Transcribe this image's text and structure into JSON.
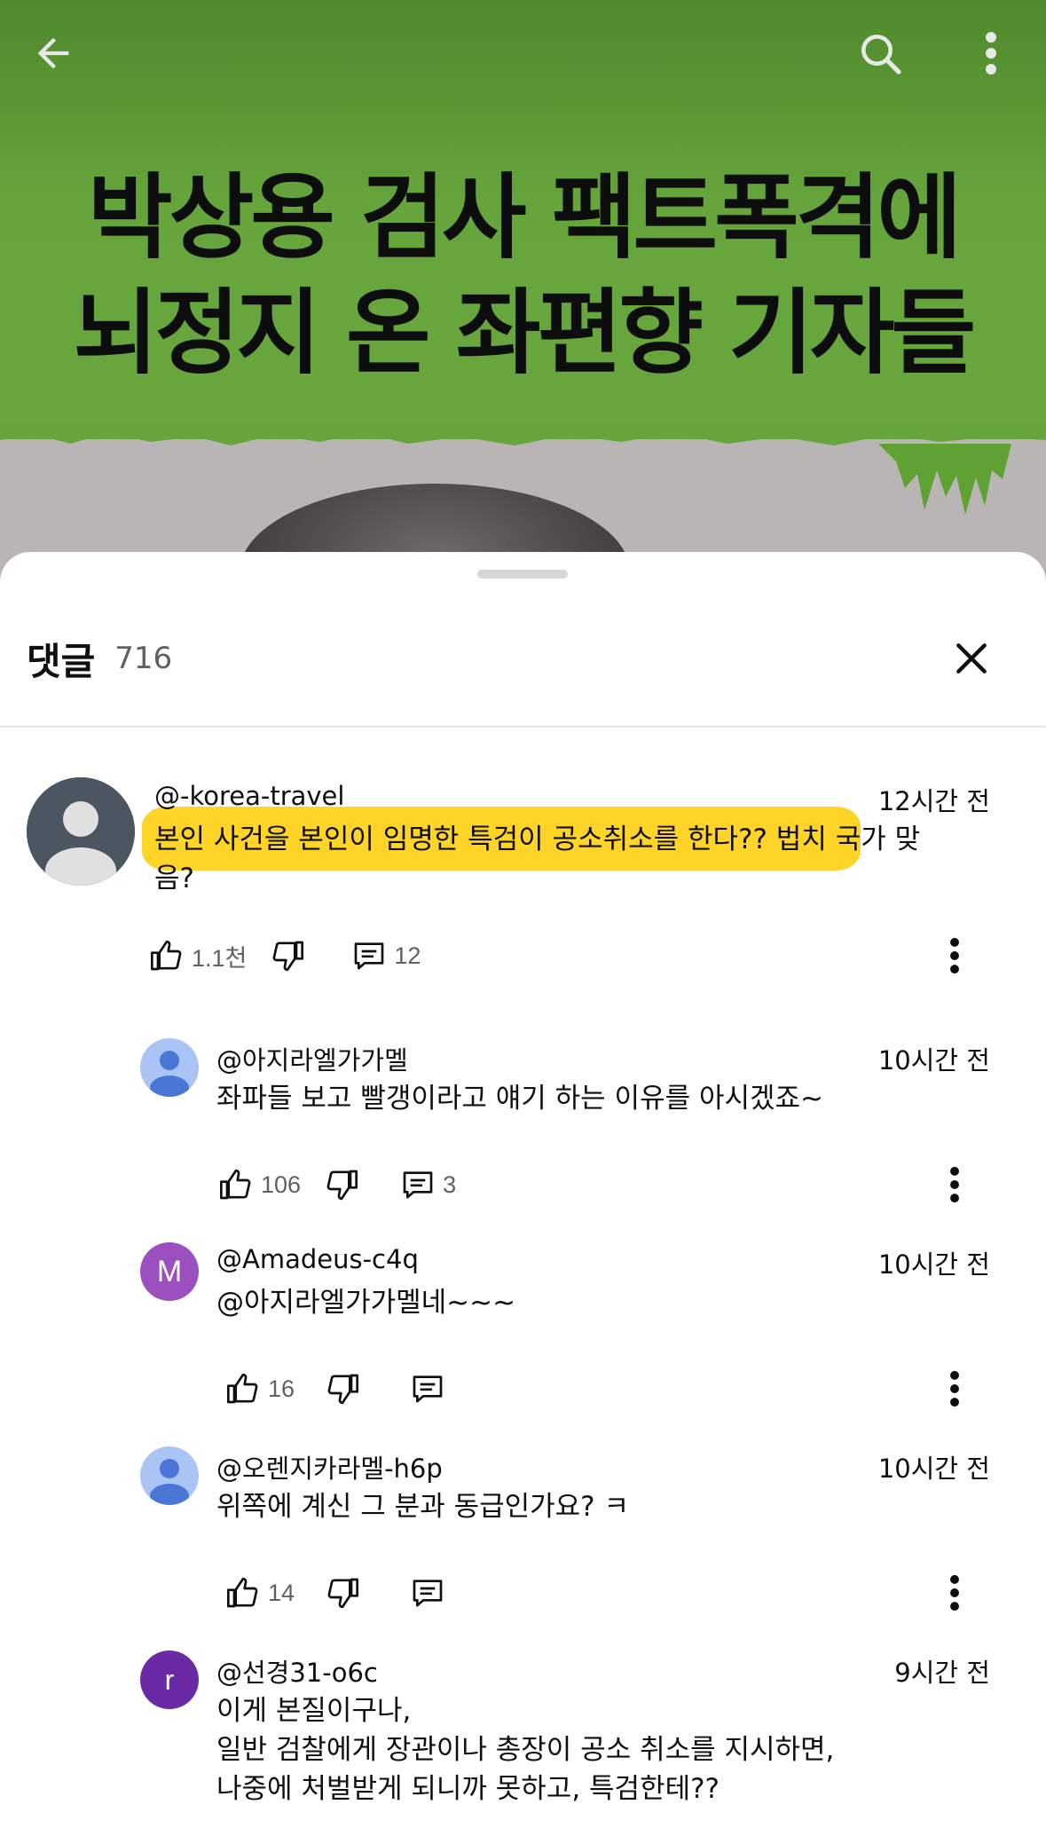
{
  "video": {
    "title_line1": "박상용 검사 팩트폭격에",
    "title_line2": "뇌정지 온 좌편향 기자들"
  },
  "icons": {
    "back": "back-arrow-icon",
    "search": "search-icon",
    "more": "more-vertical-icon",
    "close": "close-icon",
    "like": "thumbs-up-icon",
    "dislike": "thumbs-down-icon",
    "reply": "reply-icon"
  },
  "colors": {
    "video_green": "#66a53c",
    "highlight": "#ffd21e",
    "avatar_default_bg": "#a9c4f5",
    "avatar_default_fg": "#4a77d6",
    "avatar_m": "#9c4fbf",
    "avatar_r": "#6a2aa6"
  },
  "comments_panel": {
    "title": "댓글",
    "count": "716"
  },
  "comments": [
    {
      "author": "@-korea-travel",
      "time": "12시간 전",
      "text_line1": "본인 사건을 본인이 임명한 특검이 공소취소를 한다?? 법치 국가 맞",
      "text_line2": "음?",
      "likes": "1.1천",
      "replies": "12"
    },
    {
      "author": "@아지라엘가가멜",
      "time": "10시간 전",
      "text": "좌파들 보고 빨갱이라고 얘기 하는 이유를 아시겠죠~",
      "likes": "106",
      "replies": "3"
    },
    {
      "author": "@Amadeus-c4q",
      "avatar_letter": "M",
      "time": "10시간 전",
      "text": "@아지라엘가가멜네~~~",
      "likes": "16"
    },
    {
      "author": "@오렌지카라멜-h6p",
      "time": "10시간 전",
      "text": "위쪽에 계신 그 분과 동급인가요? ㅋ",
      "likes": "14"
    },
    {
      "author": "@선경31-o6c",
      "avatar_letter": "r",
      "time": "9시간 전",
      "text_line1": "이게 본질이구나,",
      "text_line2": "일반 검찰에게 장관이나 총장이 공소 취소를 지시하면,",
      "text_line3": "나중에 처벌받게 되니까 못하고, 특검한테??"
    }
  ]
}
